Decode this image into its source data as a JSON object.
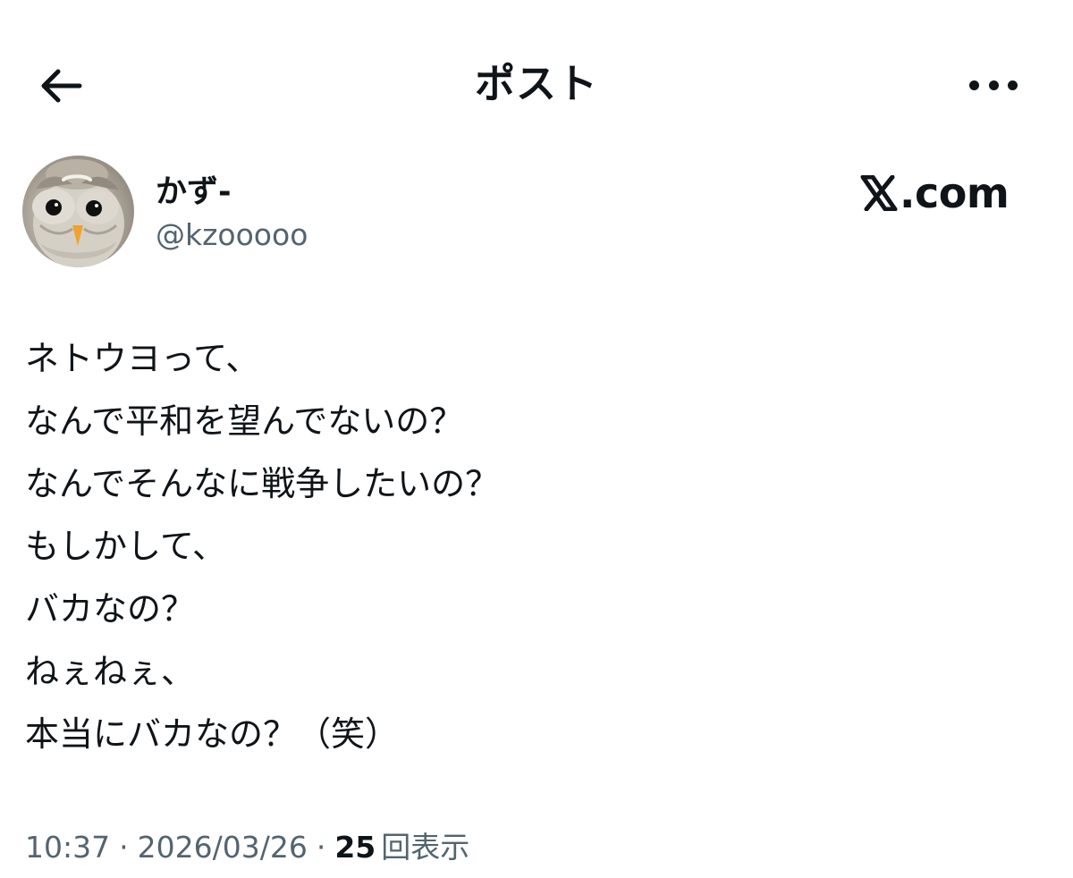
{
  "header": {
    "title": "ポスト",
    "back_icon": "arrow-left-icon",
    "more_icon": "more-horizontal-icon"
  },
  "author": {
    "display_name": "かず-",
    "handle": "@kzooooo",
    "avatar_subject": "owl-avatar",
    "source_label": ".com",
    "source_logo": "x-logo-icon"
  },
  "post": {
    "lines": [
      "ネトウヨって、",
      "なんで平和を望んでないの？",
      "なんでそんなに戦争したいの？",
      "もしかして、",
      "バカなの？",
      "ねぇねぇ、",
      "本当にバカなの？（笑）"
    ]
  },
  "meta": {
    "time": "10:37",
    "separator": "·",
    "date": "2026/03/26",
    "view_count": "25",
    "view_label": "回表示"
  },
  "colors": {
    "text_primary": "#0f1419",
    "text_secondary": "#536471",
    "background": "#ffffff"
  }
}
